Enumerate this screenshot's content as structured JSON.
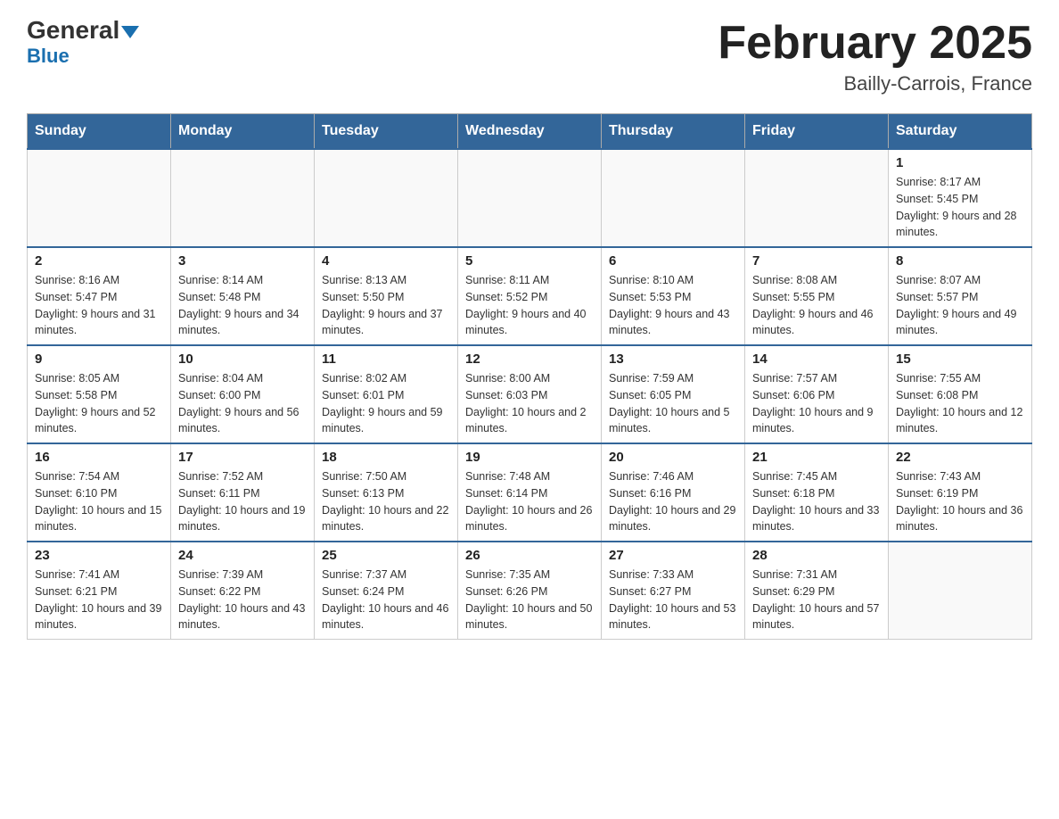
{
  "header": {
    "logo_general": "General",
    "logo_blue": "Blue",
    "main_title": "February 2025",
    "subtitle": "Bailly-Carrois, France"
  },
  "weekdays": [
    "Sunday",
    "Monday",
    "Tuesday",
    "Wednesday",
    "Thursday",
    "Friday",
    "Saturday"
  ],
  "weeks": [
    [
      {
        "day": "",
        "info": ""
      },
      {
        "day": "",
        "info": ""
      },
      {
        "day": "",
        "info": ""
      },
      {
        "day": "",
        "info": ""
      },
      {
        "day": "",
        "info": ""
      },
      {
        "day": "",
        "info": ""
      },
      {
        "day": "1",
        "info": "Sunrise: 8:17 AM\nSunset: 5:45 PM\nDaylight: 9 hours and 28 minutes."
      }
    ],
    [
      {
        "day": "2",
        "info": "Sunrise: 8:16 AM\nSunset: 5:47 PM\nDaylight: 9 hours and 31 minutes."
      },
      {
        "day": "3",
        "info": "Sunrise: 8:14 AM\nSunset: 5:48 PM\nDaylight: 9 hours and 34 minutes."
      },
      {
        "day": "4",
        "info": "Sunrise: 8:13 AM\nSunset: 5:50 PM\nDaylight: 9 hours and 37 minutes."
      },
      {
        "day": "5",
        "info": "Sunrise: 8:11 AM\nSunset: 5:52 PM\nDaylight: 9 hours and 40 minutes."
      },
      {
        "day": "6",
        "info": "Sunrise: 8:10 AM\nSunset: 5:53 PM\nDaylight: 9 hours and 43 minutes."
      },
      {
        "day": "7",
        "info": "Sunrise: 8:08 AM\nSunset: 5:55 PM\nDaylight: 9 hours and 46 minutes."
      },
      {
        "day": "8",
        "info": "Sunrise: 8:07 AM\nSunset: 5:57 PM\nDaylight: 9 hours and 49 minutes."
      }
    ],
    [
      {
        "day": "9",
        "info": "Sunrise: 8:05 AM\nSunset: 5:58 PM\nDaylight: 9 hours and 52 minutes."
      },
      {
        "day": "10",
        "info": "Sunrise: 8:04 AM\nSunset: 6:00 PM\nDaylight: 9 hours and 56 minutes."
      },
      {
        "day": "11",
        "info": "Sunrise: 8:02 AM\nSunset: 6:01 PM\nDaylight: 9 hours and 59 minutes."
      },
      {
        "day": "12",
        "info": "Sunrise: 8:00 AM\nSunset: 6:03 PM\nDaylight: 10 hours and 2 minutes."
      },
      {
        "day": "13",
        "info": "Sunrise: 7:59 AM\nSunset: 6:05 PM\nDaylight: 10 hours and 5 minutes."
      },
      {
        "day": "14",
        "info": "Sunrise: 7:57 AM\nSunset: 6:06 PM\nDaylight: 10 hours and 9 minutes."
      },
      {
        "day": "15",
        "info": "Sunrise: 7:55 AM\nSunset: 6:08 PM\nDaylight: 10 hours and 12 minutes."
      }
    ],
    [
      {
        "day": "16",
        "info": "Sunrise: 7:54 AM\nSunset: 6:10 PM\nDaylight: 10 hours and 15 minutes."
      },
      {
        "day": "17",
        "info": "Sunrise: 7:52 AM\nSunset: 6:11 PM\nDaylight: 10 hours and 19 minutes."
      },
      {
        "day": "18",
        "info": "Sunrise: 7:50 AM\nSunset: 6:13 PM\nDaylight: 10 hours and 22 minutes."
      },
      {
        "day": "19",
        "info": "Sunrise: 7:48 AM\nSunset: 6:14 PM\nDaylight: 10 hours and 26 minutes."
      },
      {
        "day": "20",
        "info": "Sunrise: 7:46 AM\nSunset: 6:16 PM\nDaylight: 10 hours and 29 minutes."
      },
      {
        "day": "21",
        "info": "Sunrise: 7:45 AM\nSunset: 6:18 PM\nDaylight: 10 hours and 33 minutes."
      },
      {
        "day": "22",
        "info": "Sunrise: 7:43 AM\nSunset: 6:19 PM\nDaylight: 10 hours and 36 minutes."
      }
    ],
    [
      {
        "day": "23",
        "info": "Sunrise: 7:41 AM\nSunset: 6:21 PM\nDaylight: 10 hours and 39 minutes."
      },
      {
        "day": "24",
        "info": "Sunrise: 7:39 AM\nSunset: 6:22 PM\nDaylight: 10 hours and 43 minutes."
      },
      {
        "day": "25",
        "info": "Sunrise: 7:37 AM\nSunset: 6:24 PM\nDaylight: 10 hours and 46 minutes."
      },
      {
        "day": "26",
        "info": "Sunrise: 7:35 AM\nSunset: 6:26 PM\nDaylight: 10 hours and 50 minutes."
      },
      {
        "day": "27",
        "info": "Sunrise: 7:33 AM\nSunset: 6:27 PM\nDaylight: 10 hours and 53 minutes."
      },
      {
        "day": "28",
        "info": "Sunrise: 7:31 AM\nSunset: 6:29 PM\nDaylight: 10 hours and 57 minutes."
      },
      {
        "day": "",
        "info": ""
      }
    ]
  ]
}
